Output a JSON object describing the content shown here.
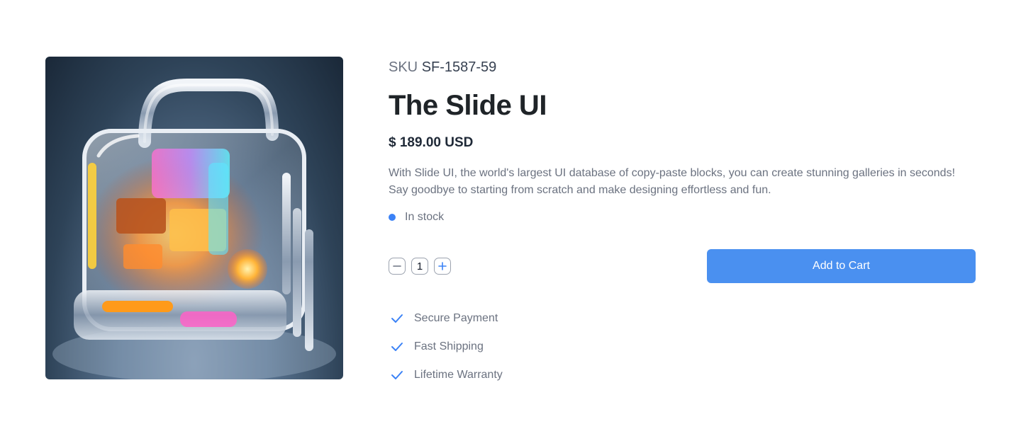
{
  "product": {
    "image_alt": "Translucent futuristic glowing computer case",
    "sku_label": "SKU",
    "sku_value": "SF-1587-59",
    "title": "The Slide UI",
    "price": "$ 189.00 USD",
    "description": "With Slide UI, the world's largest UI database of copy-paste blocks, you can create stunning galleries in seconds! Say goodbye to starting from scratch and make designing effortless and fun.",
    "stock_status": "In stock"
  },
  "quantity": {
    "value": "1"
  },
  "cart": {
    "button_label": "Add to Cart"
  },
  "features": [
    {
      "label": "Secure Payment",
      "icon": "check-icon"
    },
    {
      "label": "Fast Shipping",
      "icon": "check-icon"
    },
    {
      "label": "Lifetime Warranty",
      "icon": "check-icon"
    }
  ],
  "colors": {
    "accent": "#4a90f0",
    "stock_dot": "#3b82f6",
    "text_muted": "#6b7280",
    "heading": "#1f2428"
  }
}
